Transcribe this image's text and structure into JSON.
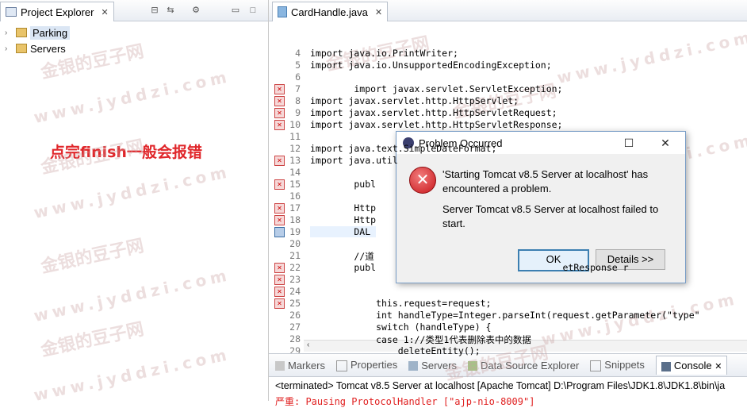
{
  "project_explorer": {
    "tab_label": "Project Explorer",
    "tab_close": "✕",
    "tree": [
      {
        "label": "Parking",
        "selected": true
      },
      {
        "label": "Servers",
        "selected": false
      }
    ]
  },
  "annotation_text": "点完finish一般会报错",
  "editor": {
    "tab_label": "CardHandle.java",
    "tab_close": "✕",
    "line_numbers": [
      "4",
      "5",
      "6",
      "7",
      "8",
      "9",
      "10",
      "11",
      "12",
      "13",
      "14",
      "15",
      "16",
      "17",
      "18",
      "19",
      "20",
      "21",
      "22",
      "23",
      "24",
      "25",
      "26",
      "27",
      "28",
      "29"
    ],
    "lines": [
      {
        "t": "import java.io.PrintWriter;"
      },
      {
        "t": "import java.io.UnsupportedEncodingException;"
      },
      {
        "t": ""
      },
      {
        "t": "        import javax.servlet.ServletException;"
      },
      {
        "t": "import javax.servlet.http.HttpServlet;"
      },
      {
        "t": "import javax.servlet.http.HttpServletRequest;"
      },
      {
        "t": "import javax.servlet.http.HttpServletResponse;"
      },
      {
        "t": ""
      },
      {
        "t": "import java.text.SimpleDateFormat;"
      },
      {
        "t": "import java.util"
      },
      {
        "t": ""
      },
      {
        "t": "        publ"
      },
      {
        "t": ""
      },
      {
        "t": "        Http"
      },
      {
        "t": "        Http"
      },
      {
        "t": "        DAL "
      },
      {
        "t": ""
      },
      {
        "t": "        //道"
      },
      {
        "t": "        publ                                  etResponse r"
      },
      {
        "t": ""
      },
      {
        "t": ""
      },
      {
        "t": "            this.request=request;"
      },
      {
        "t": "            int handleType=Integer.parseInt(request.getParameter(\"type\""
      },
      {
        "t": "            switch (handleType) {"
      },
      {
        "t": "            case 1://类型1代表删除表中的数据"
      },
      {
        "t": "                deleteEntity();"
      }
    ]
  },
  "bottom_panel": {
    "tabs": [
      "Markers",
      "Properties",
      "Servers",
      "Data Source Explorer",
      "Snippets",
      "Console"
    ],
    "active_tab": "Console",
    "console_close": "✕",
    "console_line1": "<terminated> Tomcat v8.5 Server at localhost [Apache Tomcat] D:\\Program Files\\JDK1.8\\JDK1.8\\bin\\ja",
    "console_line2": "严重: Pausing ProtocolHandler [\"ajp-nio-8009\"]"
  },
  "dialog": {
    "title": "Problem Occurred",
    "message1": "'Starting Tomcat v8.5 Server at localhost' has encountered a problem.",
    "message2": "Server Tomcat v8.5 Server at localhost failed to start.",
    "ok_label": "OK",
    "details_label": "Details >>"
  },
  "watermark": {
    "line1": "金银的豆子网",
    "line2": "www.jyddzi.com"
  }
}
